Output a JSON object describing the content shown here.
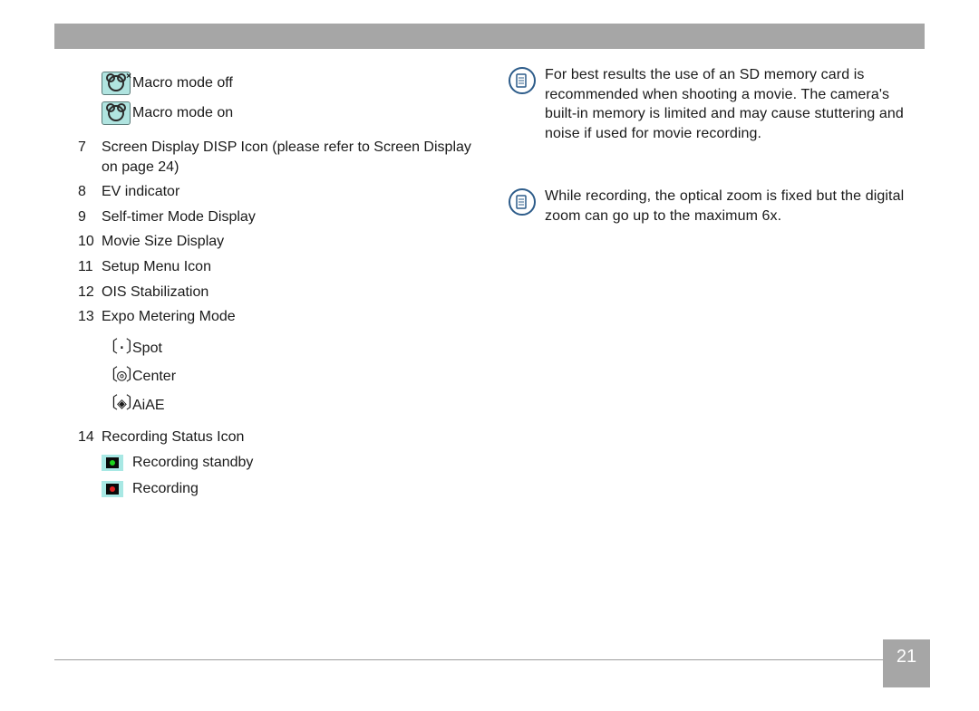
{
  "page_number": "21",
  "left_col": {
    "macro_modes": [
      {
        "label": "Macro mode off",
        "icon": "macro-off-icon",
        "x": true
      },
      {
        "label": "Macro mode on",
        "icon": "macro-on-icon",
        "x": false
      }
    ],
    "numbered": [
      {
        "num": "7",
        "text": "Screen Display DISP Icon (please refer to Screen Display on page 24)"
      },
      {
        "num": "8",
        "text": "EV indicator"
      },
      {
        "num": "9",
        "text": "Self-timer Mode Display"
      },
      {
        "num": "10",
        "text": "Movie Size Display"
      },
      {
        "num": "11",
        "text": "Setup Menu Icon"
      },
      {
        "num": "12",
        "text": "OIS Stabilization"
      },
      {
        "num": "13",
        "text": "Expo Metering Mode"
      }
    ],
    "metering_modes": [
      {
        "glyph": "〔·〕",
        "label": "Spot"
      },
      {
        "glyph": "〔◎〕",
        "label": "Center"
      },
      {
        "glyph": "〔◈〕",
        "label": "AiAE"
      }
    ],
    "item14": {
      "num": "14",
      "text": "Recording Status Icon"
    },
    "recording_states": [
      {
        "color": "green",
        "label": "Recording standby"
      },
      {
        "color": "red",
        "label": "Recording"
      }
    ]
  },
  "right_col": {
    "notes": [
      {
        "text": "For best results the use of an SD memory card is recommended when shooting a movie. The camera's built-in memory is limited and may cause stuttering and noise if used for movie recording."
      },
      {
        "text": "While recording, the optical zoom is fixed but the digital zoom can go up to the maximum 6x."
      }
    ]
  }
}
